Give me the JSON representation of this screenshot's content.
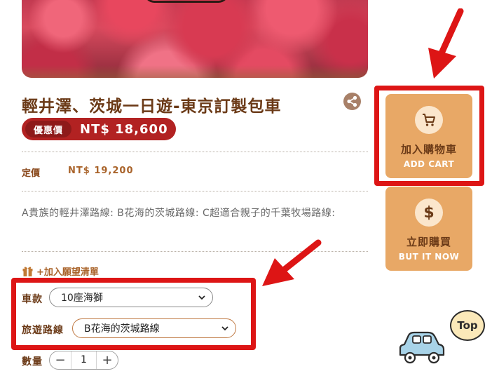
{
  "product": {
    "title": "輕井澤、茨城一日遊-東京訂製包車",
    "sale_label": "優惠價",
    "sale_price": "NT$ 18,600",
    "original_label": "定價",
    "original_price": "NT$ 19,200",
    "description": "A貴族的輕井澤路線: B花海的茨城路線: C超適合親子的千葉牧場路線:"
  },
  "wishlist": {
    "label": "+加入願望清單"
  },
  "options": {
    "vehicle": {
      "label": "車款",
      "selected": "10座海獅"
    },
    "route": {
      "label": "旅遊路線",
      "selected": "B花海的茨城路線"
    },
    "quantity": {
      "label": "數量",
      "value": "1",
      "minus": "−",
      "plus": "+"
    }
  },
  "actions": {
    "add_cart": {
      "label_cn": "加入購物車",
      "label_en": "ADD CART"
    },
    "buy_now": {
      "label_cn": "立即購買",
      "label_en": "BUT IT NOW",
      "icon_glyph": "$"
    }
  },
  "back_to_top": {
    "label": "Top"
  },
  "icons": {
    "share": "share-icon",
    "gift": "gift-icon",
    "cart": "cart-icon",
    "dollar": "dollar-icon",
    "car": "car-icon"
  },
  "colors": {
    "sale_bg": "#b22222",
    "button_bg": "#e8a866",
    "annotation_red": "#dd1515",
    "title_brown": "#6b3a17"
  }
}
